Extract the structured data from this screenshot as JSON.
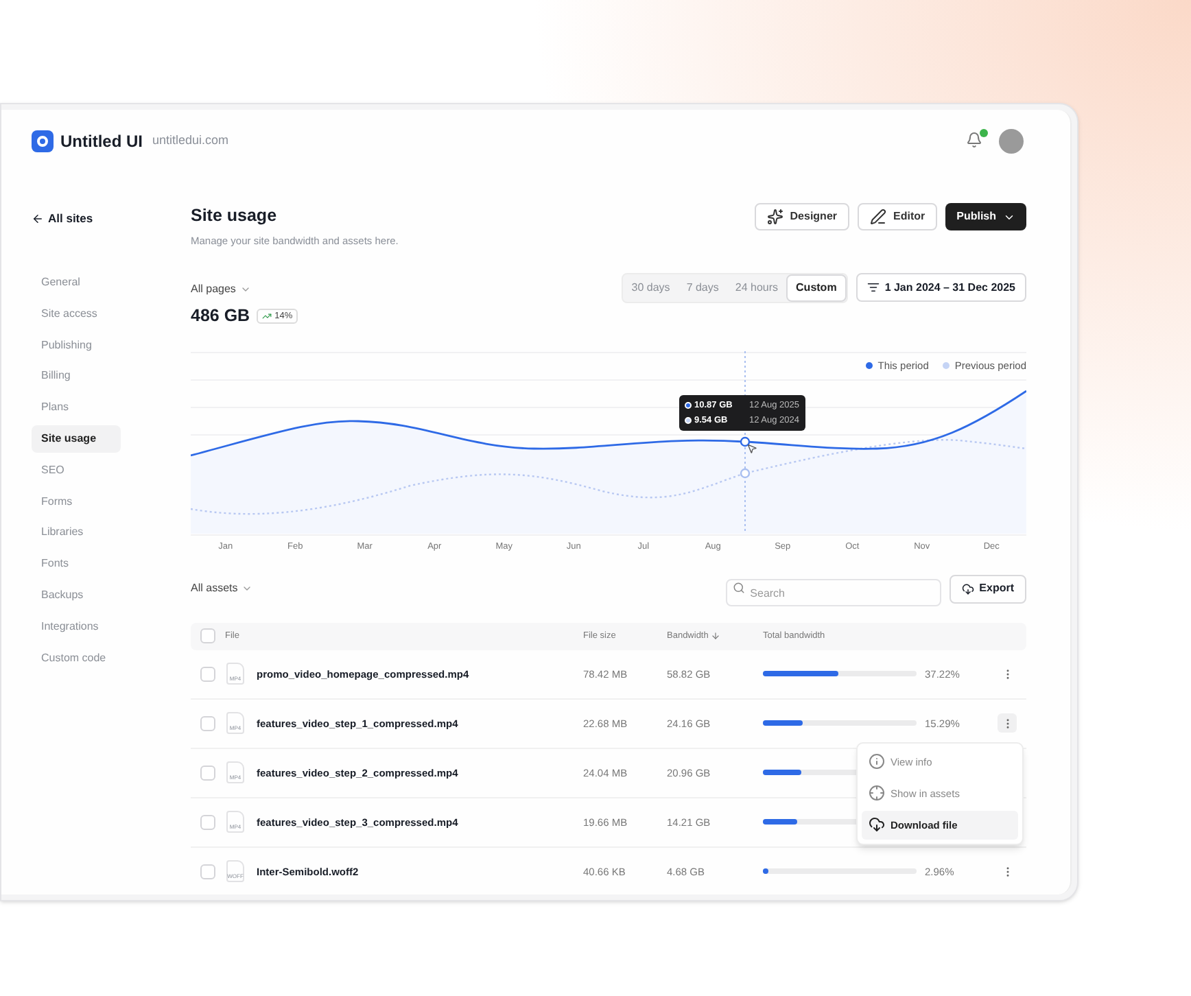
{
  "header": {
    "brand": "Untitled UI",
    "domain": "untitledui.com",
    "notification_unread": true
  },
  "back_link": "All sites",
  "sidebar": {
    "items": [
      {
        "label": "General",
        "selected": false
      },
      {
        "label": "Site access",
        "selected": false
      },
      {
        "label": "Publishing",
        "selected": false
      },
      {
        "label": "Billing",
        "selected": false
      },
      {
        "label": "Plans",
        "selected": false
      },
      {
        "label": "Site usage",
        "selected": true
      },
      {
        "label": "SEO",
        "selected": false
      },
      {
        "label": "Forms",
        "selected": false
      },
      {
        "label": "Libraries",
        "selected": false
      },
      {
        "label": "Fonts",
        "selected": false
      },
      {
        "label": "Backups",
        "selected": false
      },
      {
        "label": "Integrations",
        "selected": false
      },
      {
        "label": "Custom code",
        "selected": false
      }
    ]
  },
  "page": {
    "title": "Site usage",
    "subtitle": "Manage your site bandwidth and assets here.",
    "actions": [
      {
        "label": "Designer",
        "kind": "designer"
      },
      {
        "label": "Editor",
        "kind": "editor"
      },
      {
        "label": "Publish",
        "kind": "primary"
      }
    ]
  },
  "usage": {
    "filter": "All pages",
    "total": "486 GB",
    "change": "14%",
    "ranges": [
      {
        "label": "30 days",
        "selected": false
      },
      {
        "label": "7 days",
        "selected": false
      },
      {
        "label": "24 hours",
        "selected": false
      },
      {
        "label": "Custom",
        "selected": true
      }
    ],
    "date_range": "1 Jan 2024 – 31 Dec 2025"
  },
  "chart": {
    "legend": [
      {
        "label": "This period",
        "color": "#2e6ae6"
      },
      {
        "label": "Previous period",
        "color": "#c5d4f5"
      }
    ],
    "months": [
      "Jan",
      "Feb",
      "Mar",
      "Apr",
      "May",
      "Jun",
      "Jul",
      "Aug",
      "Sep",
      "Oct",
      "Nov",
      "Dec"
    ],
    "tooltip": [
      {
        "value": "10.87 GB",
        "date": "12 Aug 2025",
        "color": "#2e6ae6"
      },
      {
        "value": "9.54 GB",
        "date": "12 Aug 2024",
        "color": "#c5d4f5"
      }
    ]
  },
  "assets": {
    "filter": "All assets",
    "search_placeholder": "Search",
    "export": "Export",
    "all_checked": false,
    "columns": [
      {
        "label": "File",
        "sorted": false
      },
      {
        "label": "File size",
        "sorted": false
      },
      {
        "label": "Bandwidth",
        "sorted": true
      },
      {
        "label": "Total bandwidth",
        "sorted": false
      }
    ],
    "rows": [
      {
        "name": "promo_video_homepage_compressed.mp4",
        "type": "MP4",
        "size": "78.42 MB",
        "bandwidth": "58.82 GB",
        "level": 0.49,
        "percent": "37.22%",
        "checked": false
      },
      {
        "name": "features_video_step_1_compressed.mp4",
        "type": "MP4",
        "size": "22.68 MB",
        "bandwidth": "24.16 GB",
        "level": 0.26,
        "percent": "15.29%",
        "checked": false,
        "menu": [
          {
            "label": "View info",
            "kind": "info",
            "selected": false
          },
          {
            "label": "Show in assets",
            "kind": "locate",
            "selected": false
          },
          {
            "label": "Download file",
            "kind": "download",
            "selected": true
          }
        ]
      },
      {
        "name": "features_video_step_2_compressed.mp4",
        "type": "MP4",
        "size": "24.04 MB",
        "bandwidth": "20.96 GB",
        "level": 0.25,
        "checked": false
      },
      {
        "name": "features_video_step_3_compressed.mp4",
        "type": "MP4",
        "size": "19.66 MB",
        "bandwidth": "14.21 GB",
        "level": 0.22,
        "checked": false
      },
      {
        "name": "Inter-Semibold.woff2",
        "type": "WOFF",
        "size": "40.66 KB",
        "bandwidth": "4.68 GB",
        "level": 0.04,
        "percent": "2.96%",
        "checked": false
      }
    ]
  }
}
